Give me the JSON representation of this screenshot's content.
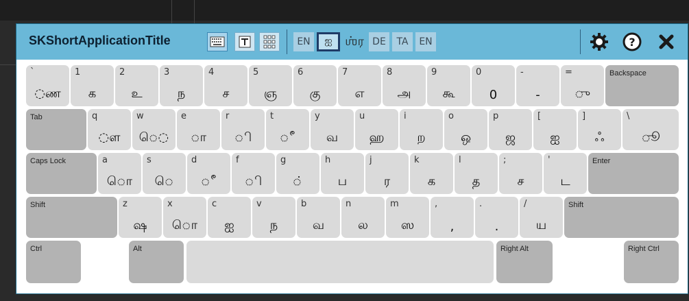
{
  "window": {
    "title": "SKShortApplicationTitle",
    "toolbar_icons": [
      {
        "name": "keyboard-icon",
        "glyph": "⌨"
      },
      {
        "name": "text-tool-icon",
        "glyph": "T"
      },
      {
        "name": "grid-icon",
        "glyph": "▦"
      }
    ],
    "languages": [
      {
        "label": "EN",
        "style": "normal"
      },
      {
        "label": "ஐ",
        "style": "selected"
      },
      {
        "label": "ஶ்ர",
        "style": "plain"
      },
      {
        "label": "DE",
        "style": "normal"
      },
      {
        "label": "TA",
        "style": "normal"
      },
      {
        "label": "EN",
        "style": "normal"
      }
    ],
    "actions": [
      {
        "name": "settings-icon",
        "glyph": "⚙"
      },
      {
        "name": "help-icon",
        "glyph": "?"
      },
      {
        "name": "close-icon",
        "glyph": "✖"
      }
    ]
  },
  "keyboard": {
    "rows": [
      [
        {
          "lat": "`",
          "tam": "◌ண"
        },
        {
          "lat": "1",
          "tam": "க"
        },
        {
          "lat": "2",
          "tam": "உ"
        },
        {
          "lat": "3",
          "tam": "ந"
        },
        {
          "lat": "4",
          "tam": "ச"
        },
        {
          "lat": "5",
          "tam": "ஞ"
        },
        {
          "lat": "6",
          "tam": "கு"
        },
        {
          "lat": "7",
          "tam": "எ"
        },
        {
          "lat": "8",
          "tam": "அ"
        },
        {
          "lat": "9",
          "tam": "கூ"
        },
        {
          "lat": "0",
          "tam": "0"
        },
        {
          "lat": "-",
          "tam": "-"
        },
        {
          "lat": "=",
          "tam": "ு"
        },
        {
          "fn": "Backspace"
        }
      ],
      [
        {
          "fn": "Tab"
        },
        {
          "lat": "q",
          "tam": "◌ள"
        },
        {
          "lat": "w",
          "tam": "ெ◌"
        },
        {
          "lat": "e",
          "tam": "◌ா"
        },
        {
          "lat": "r",
          "tam": "ி"
        },
        {
          "lat": "t",
          "tam": "◌ீ"
        },
        {
          "lat": "y",
          "tam": "வ"
        },
        {
          "lat": "u",
          "tam": "ஹ"
        },
        {
          "lat": "i",
          "tam": "ற"
        },
        {
          "lat": "o",
          "tam": "ஒ"
        },
        {
          "lat": "p",
          "tam": "ஜ"
        },
        {
          "lat": "[",
          "tam": "ஐ"
        },
        {
          "lat": "]",
          "tam": "ஃ"
        },
        {
          "lat": "\\",
          "tam": "ூ"
        }
      ],
      [
        {
          "fn": "Caps Lock"
        },
        {
          "lat": "a",
          "tam": "ொ"
        },
        {
          "lat": "s",
          "tam": "ெ"
        },
        {
          "lat": "d",
          "tam": "ீ"
        },
        {
          "lat": "f",
          "tam": "ி"
        },
        {
          "lat": "g",
          "tam": "◌்"
        },
        {
          "lat": "h",
          "tam": "ப"
        },
        {
          "lat": "j",
          "tam": "ர"
        },
        {
          "lat": "k",
          "tam": "க"
        },
        {
          "lat": "l",
          "tam": "த"
        },
        {
          "lat": ";",
          "tam": "ச"
        },
        {
          "lat": "'",
          "tam": "ட"
        },
        {
          "fn": "Enter"
        }
      ],
      [
        {
          "fn": "Shift"
        },
        {
          "lat": "z",
          "tam": "ஷ"
        },
        {
          "lat": "x",
          "tam": "◌ொ"
        },
        {
          "lat": "c",
          "tam": "ஐ"
        },
        {
          "lat": "v",
          "tam": "ந"
        },
        {
          "lat": "b",
          "tam": "வ"
        },
        {
          "lat": "n",
          "tam": "ல"
        },
        {
          "lat": "m",
          "tam": "ஸ"
        },
        {
          "lat": ",",
          "tam": ","
        },
        {
          "lat": ".",
          "tam": "."
        },
        {
          "lat": "/",
          "tam": "ய"
        },
        {
          "fn": "Shift"
        }
      ],
      [
        {
          "fn": "Ctrl"
        },
        {
          "fn": "Alt"
        },
        {
          "fn": ""
        },
        {
          "fn": "Right Alt"
        },
        {
          "fn": "Right Ctrl"
        }
      ]
    ]
  },
  "colors": {
    "titlebar": "#6ab8d8",
    "key": "#dadada",
    "key_modifier": "#b3b3b3"
  }
}
